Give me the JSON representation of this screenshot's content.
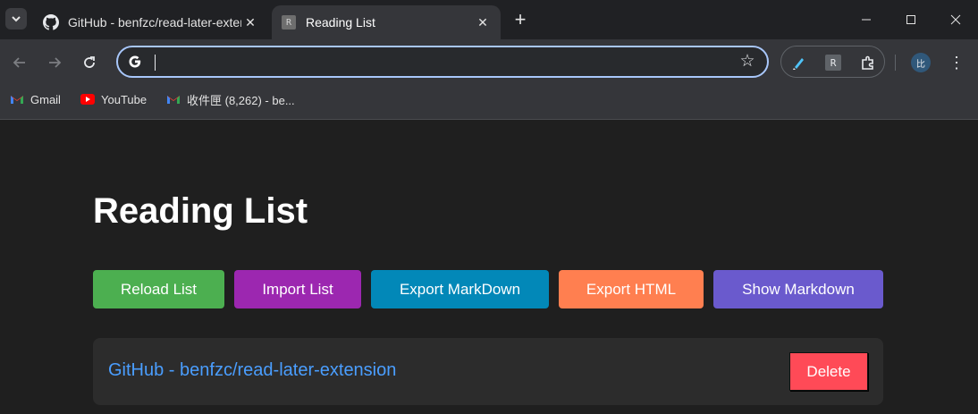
{
  "browser": {
    "tabs": [
      {
        "title": "GitHub - benfzc/read-later-extension",
        "favicon": "github-icon",
        "active": false
      },
      {
        "title": "Reading List",
        "favicon": "R",
        "active": true
      }
    ],
    "close_glyph": "✕",
    "new_tab_glyph": "+",
    "omnibox_value": "",
    "extension_badge": "R",
    "avatar_text": "比",
    "bookmarks": [
      {
        "label": "Gmail",
        "icon": "gmail-icon"
      },
      {
        "label": "YouTube",
        "icon": "youtube-icon"
      },
      {
        "label": "收件匣 (8,262) - be...",
        "icon": "gmail-icon"
      }
    ]
  },
  "page": {
    "heading": "Reading List",
    "buttons": [
      {
        "label": "Reload List",
        "color": "#4caf50"
      },
      {
        "label": "Import List",
        "color": "#9c27b0"
      },
      {
        "label": "Export MarkDown",
        "color": "#0288b8"
      },
      {
        "label": "Export HTML",
        "color": "#ff7f50"
      },
      {
        "label": "Show Markdown",
        "color": "#6a5acd"
      }
    ],
    "items": [
      {
        "title": "GitHub - benfzc/read-later-extension",
        "delete_label": "Delete"
      }
    ]
  },
  "colors": {
    "link": "#4a9eff",
    "delete": "#ff4a57",
    "omnibox_border": "#a8c7fa"
  }
}
